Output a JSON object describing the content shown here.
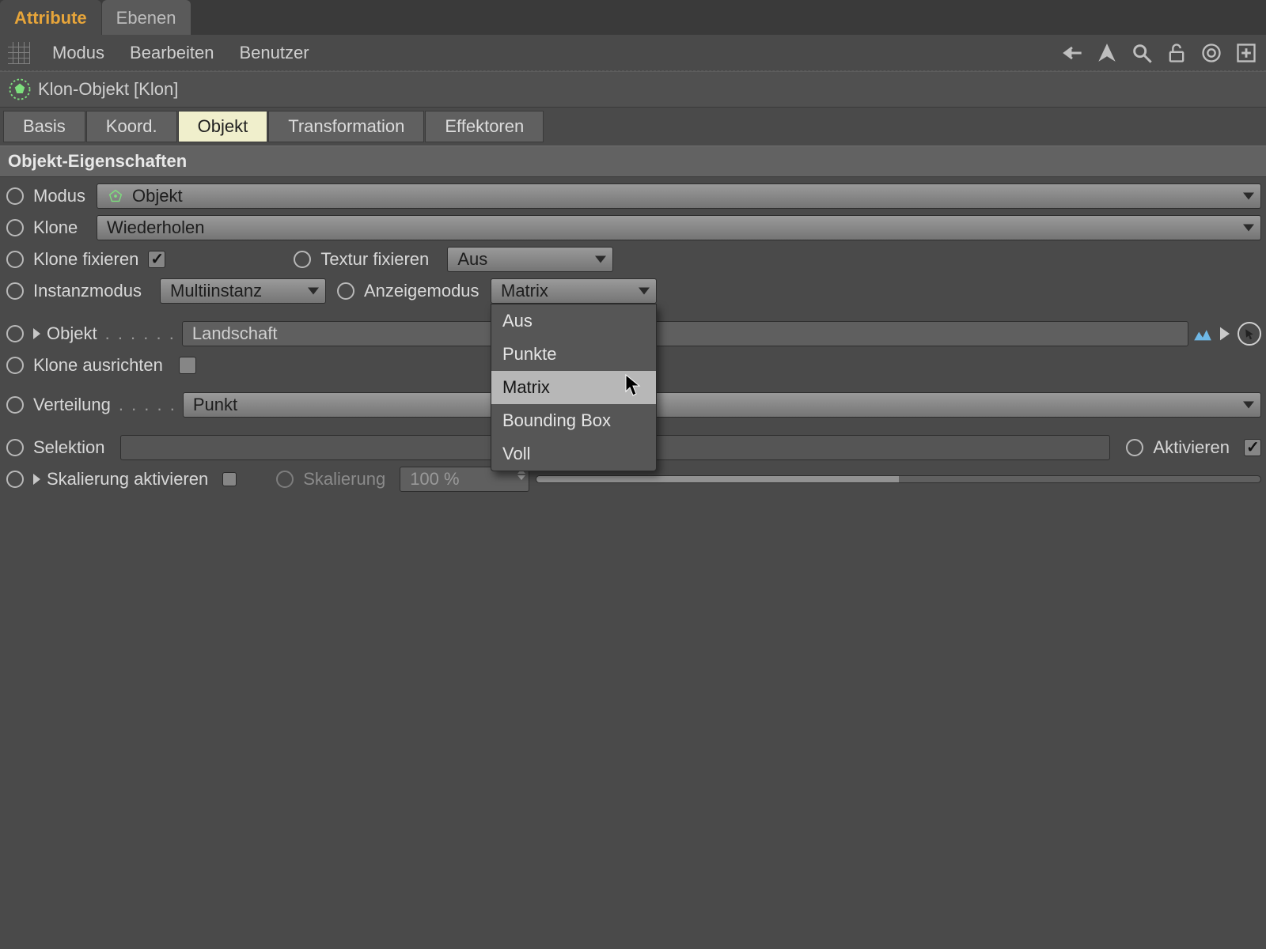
{
  "tabs": {
    "attribute": "Attribute",
    "layers": "Ebenen"
  },
  "menu": {
    "mode": "Modus",
    "edit": "Bearbeiten",
    "user": "Benutzer"
  },
  "object": {
    "icon": "cloner-icon",
    "title": "Klon-Objekt [Klon]"
  },
  "propTabs": {
    "basis": "Basis",
    "coord": "Koord.",
    "object": "Objekt",
    "transform": "Transformation",
    "effectors": "Effektoren"
  },
  "section": "Objekt-Eigenschaften",
  "labels": {
    "modus": "Modus",
    "klone": "Klone",
    "kloneFix": "Klone fixieren",
    "texturFix": "Textur fixieren",
    "instanz": "Instanzmodus",
    "anzeige": "Anzeigemodus",
    "objekt": "Objekt",
    "ausrichten": "Klone ausrichten",
    "verteilung": "Verteilung",
    "selektion": "Selektion",
    "aktivieren": "Aktivieren",
    "skalAktiv": "Skalierung aktivieren",
    "skalierung": "Skalierung"
  },
  "values": {
    "modus": "Objekt",
    "klone": "Wiederholen",
    "texturFix": "Aus",
    "instanz": "Multiinstanz",
    "anzeige": "Matrix",
    "objektLink": "Landschaft",
    "verteilung": "Punkt",
    "skalierung": "100 %"
  },
  "dropdownOptions": {
    "anzeige": [
      "Aus",
      "Punkte",
      "Matrix",
      "Bounding Box",
      "Voll"
    ],
    "highlighted": "Matrix"
  }
}
